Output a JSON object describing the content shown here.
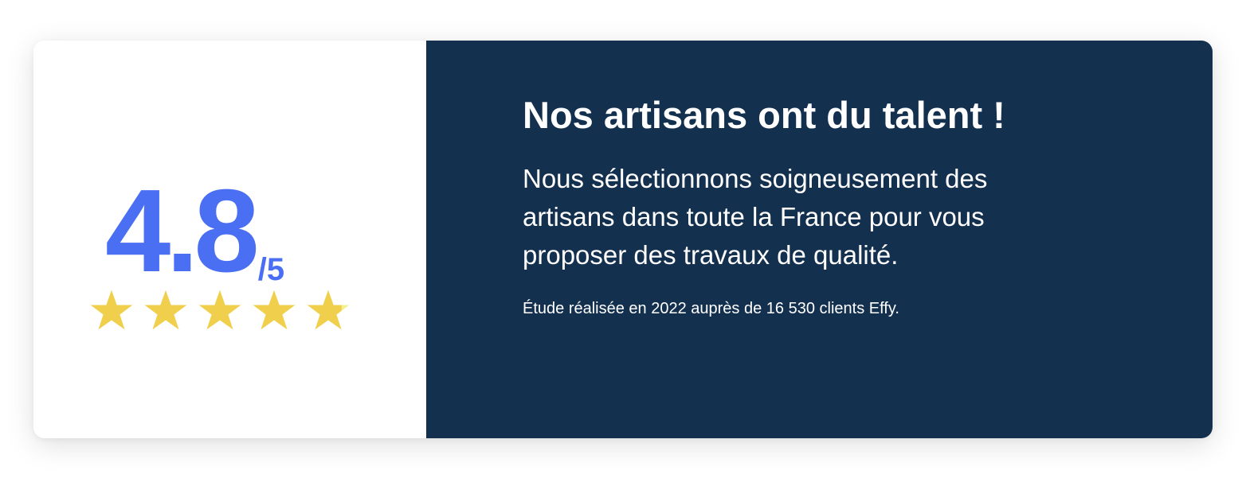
{
  "rating": {
    "score": "4.8",
    "out_of": "/5",
    "value": 4.8,
    "max": 5,
    "star_count": 5,
    "star_color": "#f0cf4c",
    "star_empty_color": "#f6ef92",
    "score_color": "#4a6ff3"
  },
  "panel": {
    "background": "#14304f",
    "headline": "Nos artisans ont du talent !",
    "body": "Nous sélectionnons soigneusement des artisans dans toute la France pour vous proposer des travaux de qualité.",
    "footnote": "Étude réalisée en 2022 auprès de 16 530 clients Effy."
  }
}
